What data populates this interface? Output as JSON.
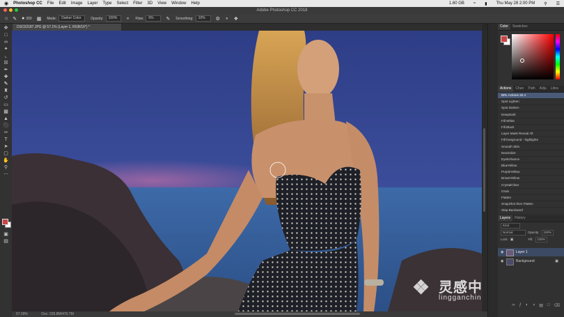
{
  "menubar": {
    "apple": "",
    "app": "Photoshop CC",
    "items": [
      "File",
      "Edit",
      "Image",
      "Layer",
      "Type",
      "Select",
      "Filter",
      "3D",
      "View",
      "Window",
      "Help"
    ],
    "right": {
      "battery": "1.60 GB",
      "datetime": "Thu May 28  2:00 PM"
    }
  },
  "window": {
    "title": "Adobe Photoshop CC 2018"
  },
  "options": {
    "brush_size": "200",
    "mode_label": "Mode:",
    "mode_value": "Darker Color",
    "opacity_label": "Opacity:",
    "opacity_value": "100%",
    "flow_label": "Flow:",
    "flow_value": "6%",
    "smoothing_label": "Smoothing:",
    "smoothing_value": "10%"
  },
  "document": {
    "tab": "DSC02187.JPG @ 57.1% (Layer 1, RGB/16*) *"
  },
  "status": {
    "zoom": "57.09%",
    "doc": "Doc: 235.8M/470.7M"
  },
  "panels": {
    "color_tabs": [
      "Color",
      "Swatches"
    ],
    "actions_tabs": [
      "Actions",
      "Chan",
      "Path",
      "Adju",
      "Libra"
    ],
    "actions": [
      "BRL Actions 20.4",
      "Spot Lighten",
      "Spot Darken",
      "DeepDark",
      "Fill White",
      "Fill Black",
      "Layer Mask Reveal All",
      "Fill foreground - highlights",
      "Smooth Skin",
      "Neutralize",
      "EyeEnhance",
      "BlueYellow",
      "PurpleYellow",
      "BrownYellow",
      "CrystalClear",
      "Grain",
      "Flatten",
      "SnapShot then Flatten",
      "Step Backward",
      "Step Forward"
    ],
    "layers_tabs": [
      "Layers",
      "History"
    ],
    "layers": {
      "kind": "Kind",
      "blend": "Normal",
      "opacity_label": "Opacity:",
      "opacity": "100%",
      "lock_label": "Lock:",
      "fill_label": "Fill:",
      "fill": "100%",
      "items": [
        "Layer 1",
        "Background"
      ]
    }
  },
  "watermark": {
    "cn": "灵感中国",
    "en": "lingganchina.com"
  }
}
